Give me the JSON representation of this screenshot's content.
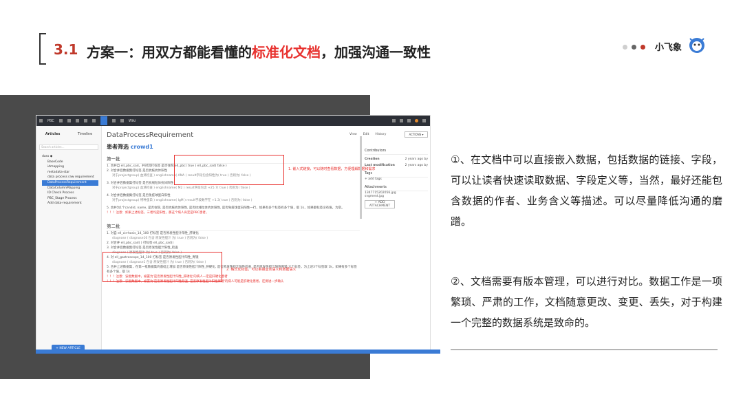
{
  "header": {
    "number": "3.1",
    "title_pre": "方案一：用双方都能看懂的",
    "title_highlight": "标准化文档",
    "title_post": "，加强沟通一致性",
    "brand": "小飞象"
  },
  "colors": {
    "accent_red": "#e8322f",
    "accent_blue": "#3a7bd5",
    "gray_panel": "#4a4a4a"
  },
  "screenshot": {
    "toolbar": {
      "app_label": "PBC",
      "wiki_label": "Wiki"
    },
    "sidebar": {
      "tabs": [
        "Articles",
        "Timeline"
      ],
      "search_placeholder": "Search articles...",
      "items": [
        {
          "label": "dass ◆",
          "level": 0
        },
        {
          "label": "BaseCode",
          "level": 1
        },
        {
          "label": "idmapping",
          "level": 1
        },
        {
          "label": "metadata-star",
          "level": 1
        },
        {
          "label": "data process raw requirement",
          "level": 1
        },
        {
          "label": "DataProcessRequirement",
          "level": 1,
          "selected": true
        },
        {
          "label": "DataColumnMapping",
          "level": 1
        },
        {
          "label": "ID Check Process",
          "level": 1
        },
        {
          "label": "PBC_Stage Process",
          "level": 1
        },
        {
          "label": "Add data-requirement",
          "level": 1
        }
      ],
      "new_article": "+ NEW ARTICLE"
    },
    "page": {
      "title": "DataProcessRequirement",
      "tabs": [
        "View",
        "Edit",
        "History"
      ],
      "actions": "ACTIONS ▾",
      "heading_prefix": "患者筛选",
      "heading_link": "crowd1",
      "batch1": "第一批",
      "batch2": "第二批",
      "lines1": [
        "1. 合并自 ell_pbc_sad。并对其打标签 是否住院 ell_pbc( true ) ell_pbc_sad( false )",
        "2. 对合并后数据集打标签 是否抗核抗体阳性",
        "对于projectgroup( 血清检查 ) englishname( ANA ) result字段包含阳性为( true ) 否则为( false )",
        "3. 对合并后数据集打标签 是否抗线粒体抗体阳性",
        "对于projectgroup( 血清检查 ) englishname( M2 ) result字段包含 +25.7( true ) 否则为( false )",
        "4. 对合并后数据集打标签 是否免疫球蛋白阳性",
        "对于projectgroup( 特种蛋白 ) englishname( IgM ) result字段数字在 +1.3( true ) 否则为( false )",
        "5. 合并为1个candid, name, 是否住院, 是否抗核抗体阳性, 是否抗线粒体抗体阳性, 是否免疫球蛋白阳性一行，如果有多个标签有多个值，取 1k，如果都标签没有值，为空。",
        "！！！注意：如果上述标签，三者均是阳性，那这个病人肯定是PBC患者。"
      ],
      "lines2": [
        "1. 对自 ell_cirrhosis_14_100 打标签 是否原发性胆汁阳性_肝硬化",
        "diagnose ( diagnose16 包含 原发性胆汁 为( true ) 否则为( false )",
        "2. 对合并 ell_pbc_sad( ) 打标签 ell_pbc_sad()",
        "3. 对合并后数据集打标签 是否原发性胆汁阳性_检查",
        "diagnose ( 原发性胆汁 为( true ) 否则为( false )",
        "4. 对 ell_gastroscope_14_100 打标签 是否原发性胆汁阳性_胃镜",
        "diagnose ( diagnose1 包含 原发性胆汁 为( true ) 否则为( false )",
        "5. 合并上述数据集，在第一批数据集的基础上增加 是否原发性胆汁阳性_肝硬化, 是否原发性胆汁阳性检查, 是否原发性胆汁阳性胃镜 三个标签，为上述3个标签取 1k，如果有多个标签有多个值，取 1k",
        "！！！注意：该批数据中，被置为'是否原发性胆汁阳性_肝硬化'的病人一定是肝硬化患者",
        "！！！注意：该批数据中，被置为'是否原发性胆汁阳性检查, 是否原发性胆汁阳性胃镜'的病人可能是肝硬化患者，还要进一步确认"
      ],
      "note1": "1. 嵌入式链接，可以随时查看数据，方便理解数据和需求",
      "note2": "2. 格式化标签，可以串接业务语义和数据语义"
    },
    "right_sidebar": {
      "contributors": "Contributors",
      "creation_label": "Creation",
      "creation_value": "2 years ago by",
      "lastmod_label": "Last modification",
      "lastmod_value": "2 years ago by",
      "tags": "Tags",
      "add_tags": "+ add tags",
      "attachments": "Attachments",
      "att1": "1347715202056.jpg",
      "att2": "svgment.jpg",
      "add_attachment": "+ ADD ATTACHMENT"
    }
  },
  "paragraphs": {
    "p1": "①、在文档中可以直接嵌入数据，包括数据的链接、字段，可以让读者快速读取数据、字段定义等，当然，最好还能包含数据的作者、业务含义等描述。可以尽量降低沟通的磨蹭。",
    "p2": "②、文档需要有版本管理，可以进行对比。数据工作是一项繁琐、严肃的工作，文档随意更改、变更、丢失，对于构建一个完整的数据系统是致命的。"
  }
}
